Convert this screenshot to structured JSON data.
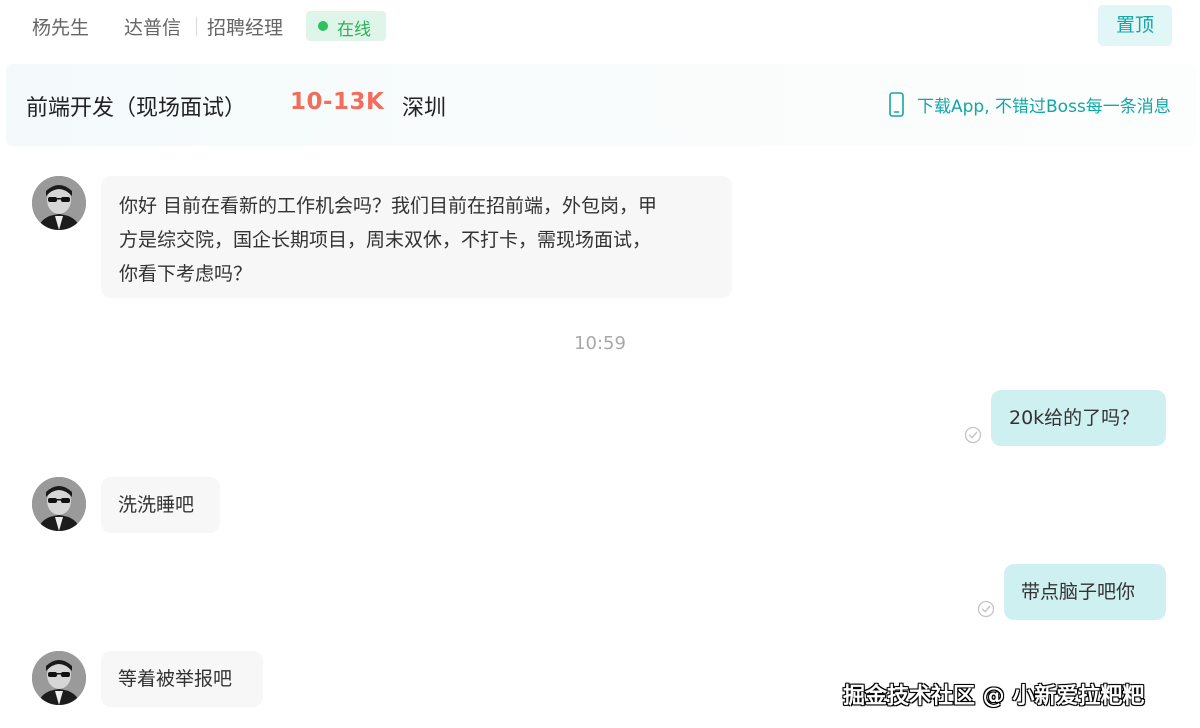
{
  "header": {
    "contact_name": "杨先生",
    "company": "达普信",
    "role": "招聘经理",
    "status": "在线",
    "pin_label": "置顶"
  },
  "job": {
    "title": "前端开发（现场面试）",
    "salary": "10-13K",
    "city": "深圳",
    "app_promo": "下载App, 不错过Boss每一条消息"
  },
  "chat": {
    "messages": [
      {
        "from": "recruiter",
        "lines": [
          "你好 目前在看新的工作机会吗？我们目前在招前端，外包岗，甲",
          "方是综交院，国企长期项目，周末双休，不打卡，需现场面试，",
          "你看下考虑吗？"
        ]
      },
      {
        "from": "me",
        "text": "20k给的了吗？"
      },
      {
        "from": "recruiter",
        "text": "洗洗睡吧"
      },
      {
        "from": "me",
        "text": "带点脑子吧你"
      },
      {
        "from": "recruiter",
        "text": "等着被举报吧"
      }
    ],
    "time_divider": "10:59"
  },
  "watermark": "掘金技术社区 @ 小新爱拉粑粑",
  "colors": {
    "accent": "#14a6a6",
    "salary": "#f26d5b",
    "online": "#2bc15f",
    "bubble_in": "#f7f7f7",
    "bubble_out": "#cff0f0"
  }
}
